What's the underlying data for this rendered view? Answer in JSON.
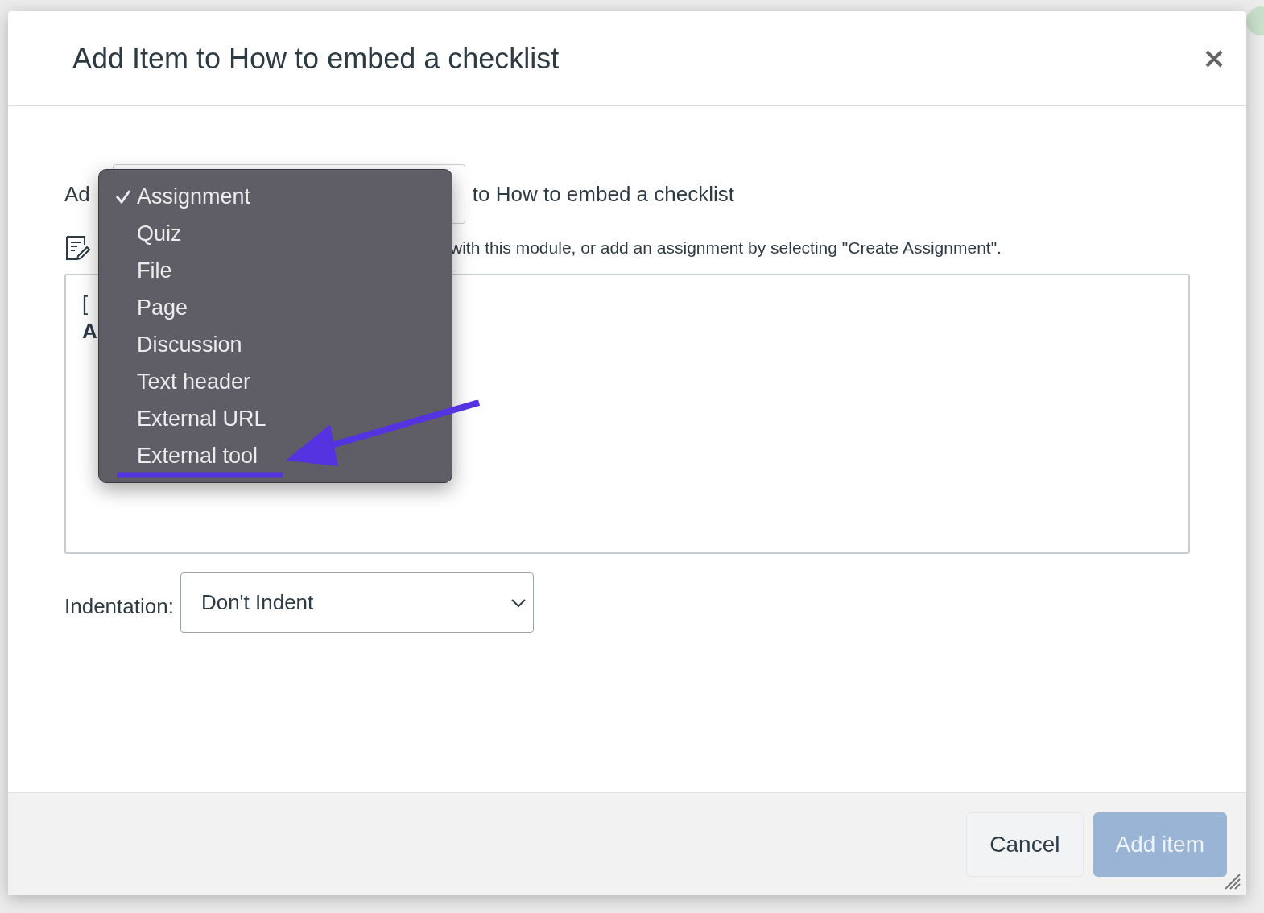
{
  "dialog": {
    "title": "Add Item to How to embed a checklist",
    "add_label": "Ad",
    "target_text": "to How to embed a checklist",
    "instruction": "with this module, or add an assignment by selecting \"Create Assignment\".",
    "list_lines": [
      {
        "text": "[",
        "bold": false
      },
      {
        "text": "A",
        "bold": true
      }
    ],
    "indentation": {
      "label": "Indentation:",
      "value": "Don't Indent"
    },
    "buttons": [
      {
        "label": "Cancel",
        "kind": "secondary",
        "disabled": false
      },
      {
        "label": "Add item",
        "kind": "primary",
        "disabled": true
      }
    ]
  },
  "type_menu": {
    "items": [
      {
        "label": "Assignment",
        "selected": true
      },
      {
        "label": "Quiz",
        "selected": false
      },
      {
        "label": "File",
        "selected": false
      },
      {
        "label": "Page",
        "selected": false
      },
      {
        "label": "Discussion",
        "selected": false
      },
      {
        "label": "Text header",
        "selected": false
      },
      {
        "label": "External URL",
        "selected": false
      },
      {
        "label": "External tool",
        "selected": false
      }
    ]
  }
}
